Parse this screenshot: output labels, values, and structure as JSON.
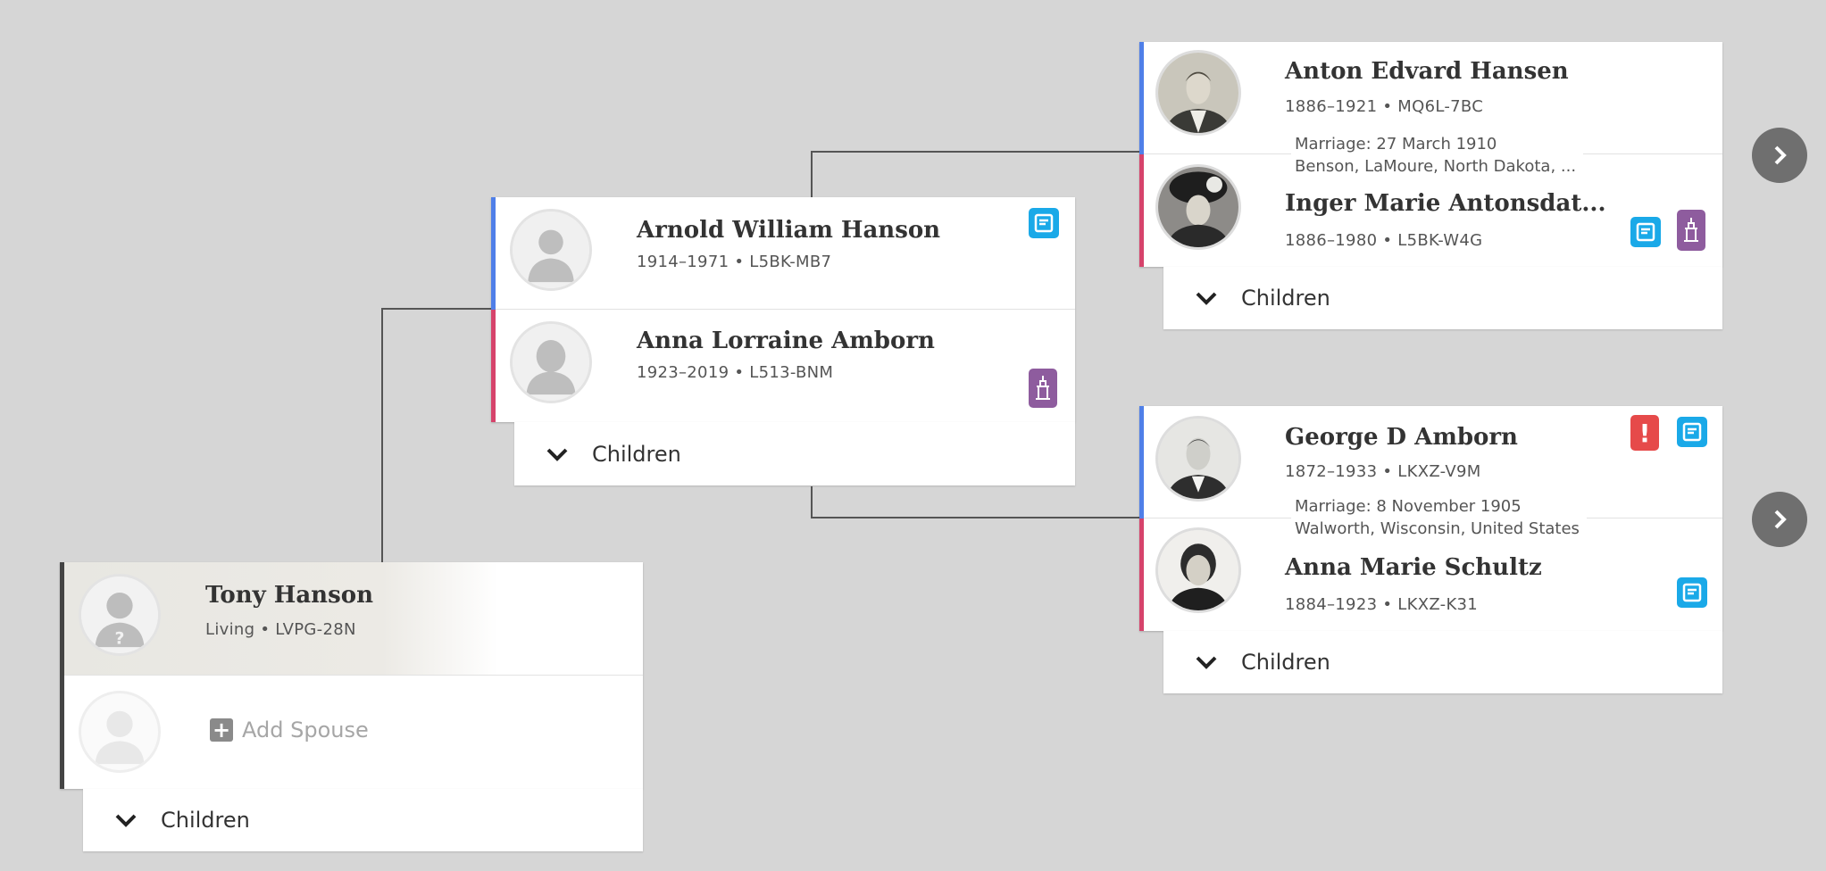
{
  "tony": {
    "name": "Tony Hanson",
    "meta": "Living • LVPG-28N",
    "add_spouse": "Add Spouse",
    "children_label": "Children"
  },
  "arnold": {
    "name": "Arnold William Hanson",
    "meta": "1914–1971 • L5BK-MB7",
    "badges": [
      "notes-icon"
    ]
  },
  "anna_lorraine": {
    "name": "Anna Lorraine Amborn",
    "meta": "1923–2019 • L513-BNM",
    "badges": [
      "temple-icon"
    ]
  },
  "arnold_family": {
    "children_label": "Children"
  },
  "anton": {
    "name": "Anton Edvard Hansen",
    "meta": "1886–1921 • MQ6L-7BC"
  },
  "anton_marriage": {
    "line1": "Marriage: 27 March 1910",
    "line2": "Benson, LaMoure, North Dakota, ..."
  },
  "inger": {
    "name": "Inger Marie Antonsdat...",
    "meta": "1886–1980 • L5BK-W4G",
    "badges": [
      "notes-icon",
      "temple-icon"
    ]
  },
  "anton_family": {
    "children_label": "Children"
  },
  "george": {
    "name": "George D Amborn",
    "meta": "1872–1933 • LKXZ-V9M",
    "badges": [
      "alert-icon",
      "notes-icon"
    ],
    "alert_glyph": "!"
  },
  "george_marriage": {
    "line1": "Marriage: 8 November 1905",
    "line2": "Walworth, Wisconsin, United States"
  },
  "anna_marie": {
    "name": "Anna Marie Schultz",
    "meta": "1884–1923 • LKXZ-K31",
    "badges": [
      "notes-icon"
    ]
  },
  "george_family": {
    "children_label": "Children"
  },
  "colors": {
    "male": "#4f7fe8",
    "female": "#d6436b",
    "notes_badge": "#1aa9e8",
    "temple_badge": "#8e5c9e",
    "alert_badge": "#e64a4a",
    "background": "#d6d6d6"
  }
}
